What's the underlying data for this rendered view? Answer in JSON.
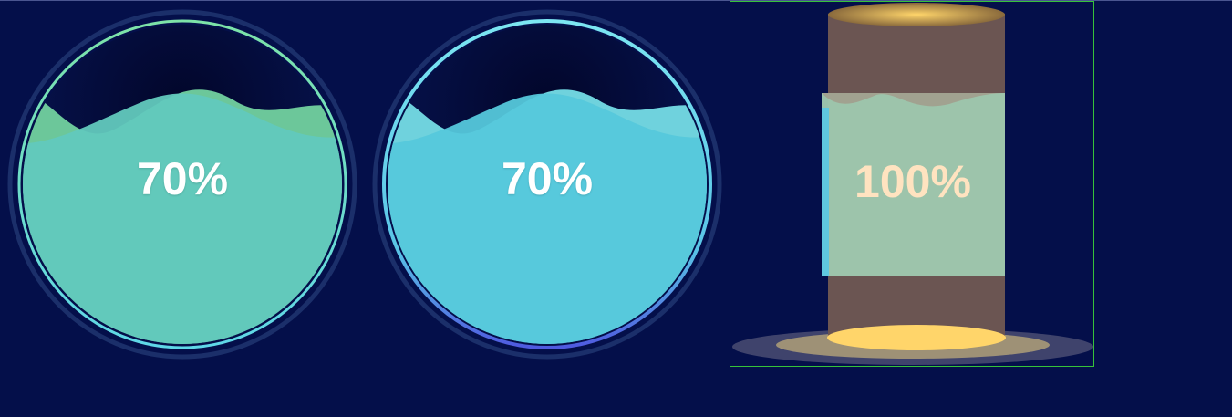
{
  "gauges": [
    {
      "label": "70%",
      "value": 0.7,
      "fill": "#62c9bd",
      "wave": "#6cc79a",
      "ring": "#7ae0b4"
    },
    {
      "label": "70%",
      "value": 0.7,
      "fill": "#55c8db",
      "wave": "#6fd2dd",
      "ring": "#7ce6f2"
    }
  ],
  "cylinder": {
    "label": "100%",
    "value": 1.0,
    "body": "#6b5552",
    "glow": "#ffd56a",
    "fill": "#9fc8ae"
  }
}
